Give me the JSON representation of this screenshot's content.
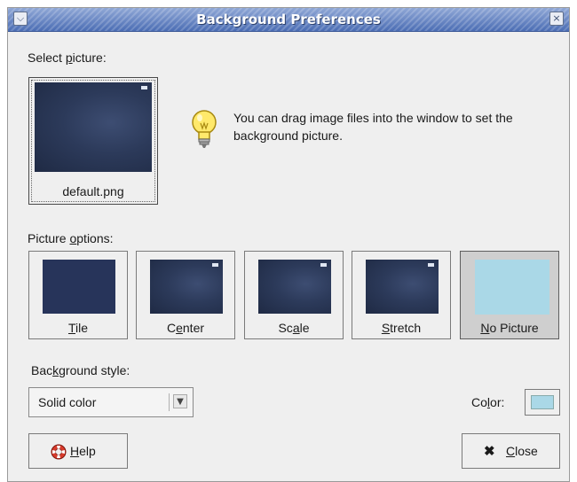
{
  "window": {
    "title": "Background Preferences",
    "menu_icon": "chevron-down-icon",
    "close_icon": "close-icon"
  },
  "select_picture": {
    "label_pre": "Select ",
    "label_u": "p",
    "label_post": "icture:",
    "current_file": "default.png"
  },
  "hint": {
    "icon": "lightbulb-icon",
    "text": "You can drag image files into the window to set the background picture."
  },
  "picture_options": {
    "label_pre": "Picture ",
    "label_u": "o",
    "label_post": "ptions:",
    "items": [
      {
        "pre": "",
        "u": "T",
        "post": "ile",
        "selected": false
      },
      {
        "pre": "C",
        "u": "e",
        "post": "nter",
        "selected": false
      },
      {
        "pre": "Sc",
        "u": "a",
        "post": "le",
        "selected": false
      },
      {
        "pre": "",
        "u": "S",
        "post": "tretch",
        "selected": false
      },
      {
        "pre": "",
        "u": "N",
        "post": "o Picture",
        "selected": true
      }
    ]
  },
  "background_style": {
    "label_pre": "Bac",
    "label_u": "k",
    "label_post": "ground style:",
    "value": "Solid color"
  },
  "color": {
    "label_pre": "Co",
    "label_u": "l",
    "label_post": "or:",
    "value": "#aad8e7"
  },
  "buttons": {
    "help": {
      "u": "H",
      "post": "elp",
      "icon": "lifebuoy-icon"
    },
    "close": {
      "u": "C",
      "post": "lose",
      "icon": "close-x-icon"
    }
  }
}
